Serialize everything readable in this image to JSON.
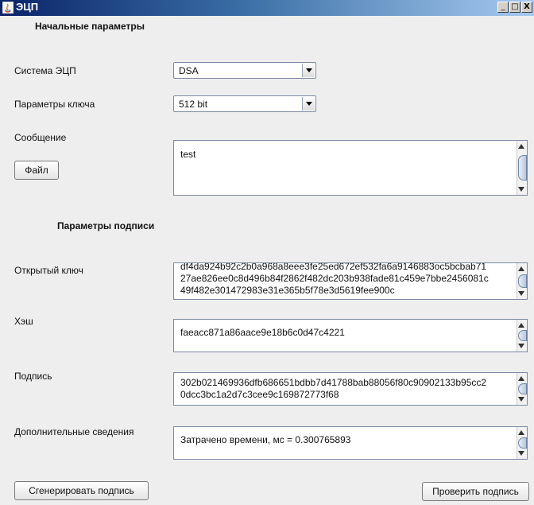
{
  "window": {
    "title": "ЭЦП",
    "minimize": "_",
    "maximize": "□",
    "close": "X"
  },
  "start_section": {
    "title": "Начальные параметры"
  },
  "signature_system": {
    "label": "Система ЭЦП",
    "selected": "DSA"
  },
  "key_params": {
    "label": "Параметры ключа",
    "selected": "512 bit"
  },
  "message": {
    "label": "Сообщение",
    "file_button": "Файл",
    "value": "test"
  },
  "sign_section": {
    "title": "Параметры подписи"
  },
  "public_key": {
    "label": "Открытый ключ",
    "value": "df4da924b92c2b0a968a8eee3fe25ed672ef532fa6a9146883oc5bcbab71\n27ae826ee0c8d496b84f2862f482dc203b938fade81c459e7bbe2456081c\n49f482e301472983e31e365b5f78e3d5619fee900c"
  },
  "hash": {
    "label": "Хэш",
    "value": "faeacc871a86aace9e18b6c0d47c4221"
  },
  "signature": {
    "label": "Подпись",
    "value": "302b021469936dfb686651bdbb7d41788bab88056f80c90902133b95cc2\n0dcc3bc1a2d7c3cee9c169872773f68"
  },
  "extra_info": {
    "label": "Дополнительные сведения",
    "value": "Затрачено времени, мс = 0.300765893"
  },
  "actions": {
    "generate": "Сгенерировать подпись",
    "verify": "Проверить подпись"
  }
}
